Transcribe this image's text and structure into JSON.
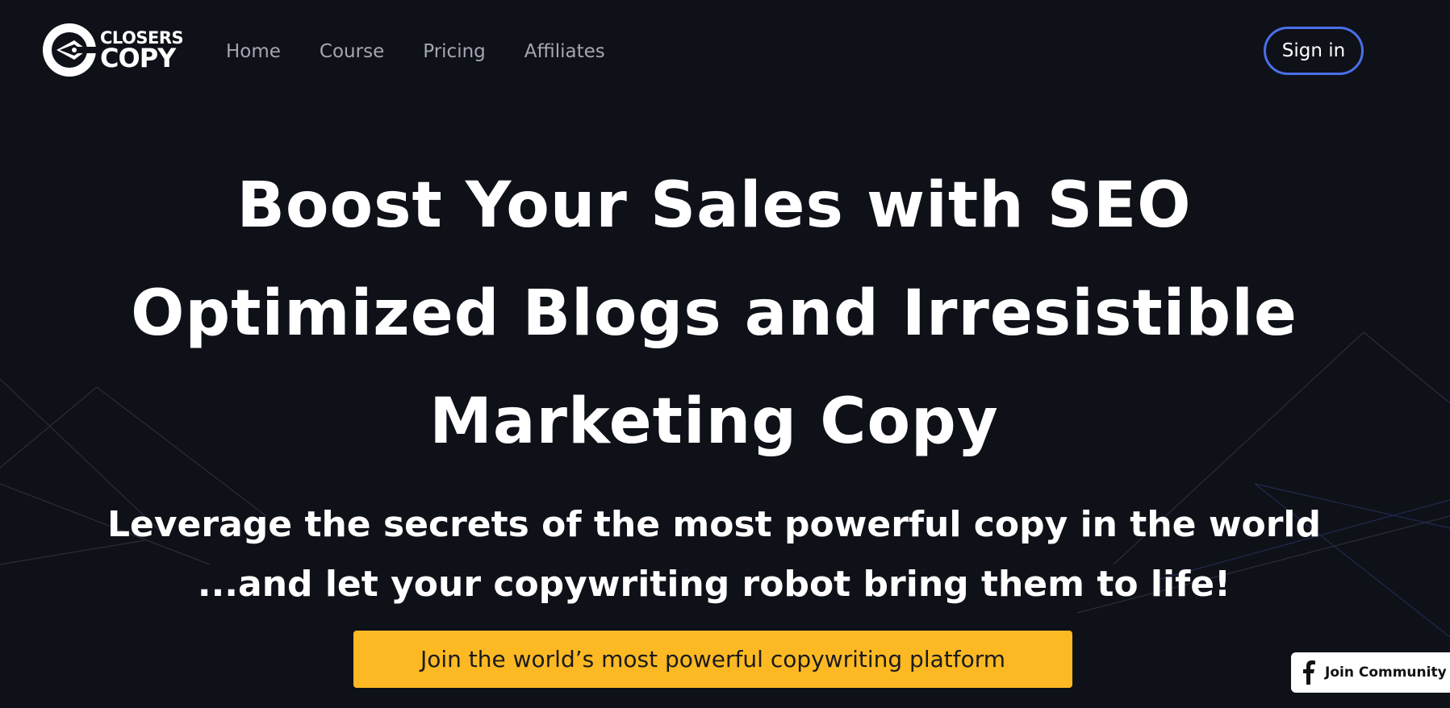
{
  "brand": {
    "line1": "CLOSERS",
    "line2": "COPY",
    "icon": "pen-nib-logo-icon"
  },
  "nav": {
    "items": [
      "Home",
      "Course",
      "Pricing",
      "Affiliates"
    ]
  },
  "header": {
    "signin_label": "Sign in"
  },
  "hero": {
    "title_lines": [
      "Boost Your Sales with SEO",
      "Optimized Blogs and Irresistible",
      "Marketing Copy"
    ],
    "subtitle_lines": [
      "Leverage the secrets of the most powerful copy in the world",
      "...and let your copywriting robot bring them to life!"
    ],
    "cta_label": "Join the world’s most powerful copywriting platform"
  },
  "community": {
    "label": "Join Community",
    "icon": "facebook-icon"
  },
  "colors": {
    "background": "#0f1119",
    "accent": "#fdb924",
    "signin_border": "#4a6fe8",
    "nav_text": "#a4a7b1"
  }
}
